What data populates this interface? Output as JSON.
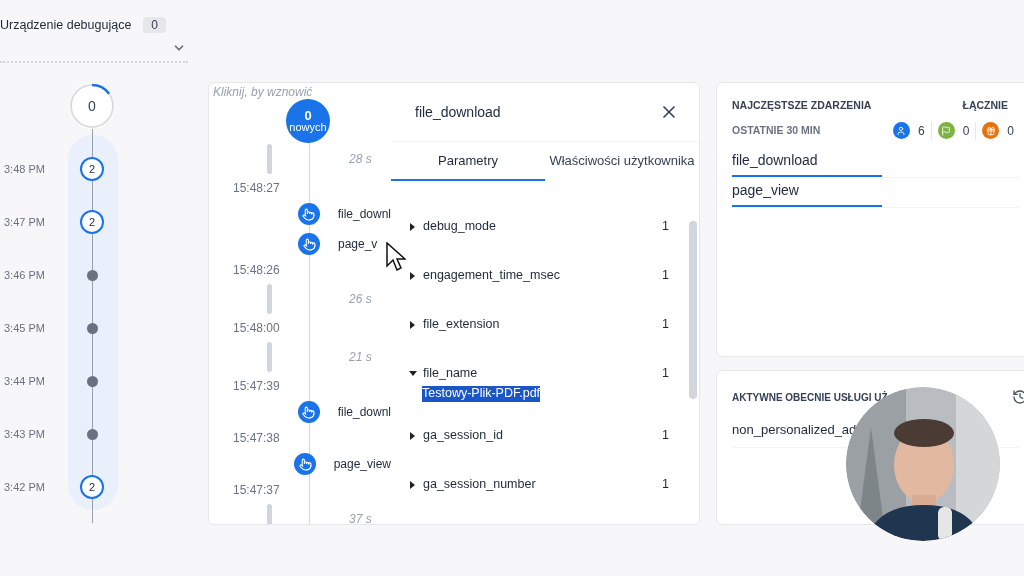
{
  "device": {
    "label": "Urządzenie debugujące",
    "count": "0"
  },
  "minutes_timeline": {
    "top": {
      "count": "0",
      "level": 0.15
    },
    "rows": [
      {
        "time": "3:48 PM",
        "kind": "count",
        "count": "2"
      },
      {
        "time": "3:47 PM",
        "kind": "count",
        "count": "2"
      },
      {
        "time": "3:46 PM",
        "kind": "dot"
      },
      {
        "time": "3:45 PM",
        "kind": "dot"
      },
      {
        "time": "3:44 PM",
        "kind": "dot"
      },
      {
        "time": "3:43 PM",
        "kind": "dot"
      },
      {
        "time": "3:42 PM",
        "kind": "count",
        "count": "2"
      }
    ]
  },
  "seconds_stream": {
    "hint": "Kliknij, by wznowić",
    "new_count": "0",
    "new_label": "nowych",
    "items": [
      {
        "kind": "gap",
        "text": "28 s"
      },
      {
        "kind": "time",
        "text": "15:48:27"
      },
      {
        "kind": "event",
        "text": "file_downl"
      },
      {
        "kind": "event",
        "text": "page_v"
      },
      {
        "kind": "time",
        "text": "15:48:26"
      },
      {
        "kind": "gap",
        "text": "26 s"
      },
      {
        "kind": "time",
        "text": "15:48:00"
      },
      {
        "kind": "gap",
        "text": "21 s"
      },
      {
        "kind": "time",
        "text": "15:47:39"
      },
      {
        "kind": "event",
        "text": "file_downl"
      },
      {
        "kind": "time",
        "text": "15:47:38"
      },
      {
        "kind": "event",
        "text": "page_view"
      },
      {
        "kind": "time",
        "text": "15:47:37"
      },
      {
        "kind": "gap",
        "text": "37 s"
      }
    ]
  },
  "event_details": {
    "title": "file_download",
    "tabs": [
      {
        "label": "Parametry",
        "selected": true
      },
      {
        "label": "Właściwości użytkownika",
        "selected": false
      }
    ],
    "parameters": [
      {
        "name": "debug_mode",
        "count": "1",
        "expanded": false
      },
      {
        "name": "engagement_time_msec",
        "count": "1",
        "expanded": false
      },
      {
        "name": "file_extension",
        "count": "1",
        "expanded": false
      },
      {
        "name": "file_name",
        "count": "1",
        "expanded": true,
        "value": "Testowy-Plik-PDF.pdf"
      },
      {
        "name": "ga_session_id",
        "count": "1",
        "expanded": false
      },
      {
        "name": "ga_session_number",
        "count": "1",
        "expanded": false
      }
    ]
  },
  "top_events": {
    "title": "NAJCZĘSTSZE ZDARZENIA",
    "total_label": "ŁĄCZNIE",
    "period": "OSTATNIE 30 MIN",
    "counters": [
      {
        "kind": "user",
        "count": "6",
        "color": "#1a73e8"
      },
      {
        "kind": "flag",
        "count": "0",
        "color": "#7cb342"
      },
      {
        "kind": "gift",
        "count": "0",
        "color": "#e8710a"
      }
    ],
    "events": [
      {
        "name": "file_download",
        "level": 0.5
      },
      {
        "name": "page_view",
        "level": 0.5
      }
    ]
  },
  "active_services": {
    "title": "AKTYWNE OBECNIE USŁUGI UŻ",
    "items": [
      "non_personalized_ad"
    ]
  }
}
